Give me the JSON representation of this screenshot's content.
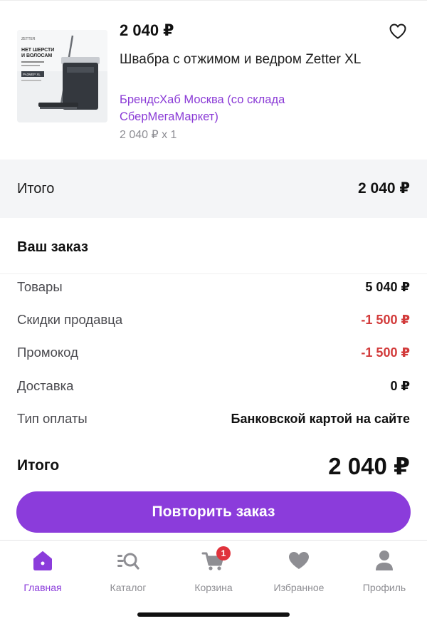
{
  "product": {
    "price": "2 040 ₽",
    "title": "Швабра с отжимом и ведром Zetter XL",
    "seller": "БрендсХаб Москва (со склада СберМегаМаркет)",
    "qty_line": "2 040 ₽ x 1",
    "image_text": {
      "brand": "ZETTER",
      "headline_1": "НЕТ ШЕРСТИ",
      "headline_2": "И ВОЛОСАМ",
      "tag": "РАЗМЕР XL"
    }
  },
  "total_band": {
    "label": "Итого",
    "value": "2 040 ₽"
  },
  "order": {
    "title": "Ваш заказ",
    "rows": [
      {
        "label": "Товары",
        "value": "5 040 ₽"
      },
      {
        "label": "Скидки продавца",
        "value": "-1 500 ₽"
      },
      {
        "label": "Промокод",
        "value": "-1 500 ₽"
      },
      {
        "label": "Доставка",
        "value": "0 ₽"
      },
      {
        "label": "Тип оплаты",
        "value": "Банковской картой на сайте"
      }
    ],
    "grand_label": "Итого",
    "grand_value": "2 040 ₽"
  },
  "repeat_button": "Повторить заказ",
  "nav": {
    "items": [
      {
        "label": "Главная",
        "icon": "home-icon",
        "active": true
      },
      {
        "label": "Каталог",
        "icon": "catalog-search-icon"
      },
      {
        "label": "Корзина",
        "icon": "cart-icon",
        "badge": "1"
      },
      {
        "label": "Избранное",
        "icon": "heart-icon"
      },
      {
        "label": "Профиль",
        "icon": "profile-icon"
      }
    ]
  },
  "colors": {
    "accent": "#8b3cdb",
    "discount": "#d23a3a",
    "badge": "#e0323c",
    "muted": "#8e8e93"
  }
}
